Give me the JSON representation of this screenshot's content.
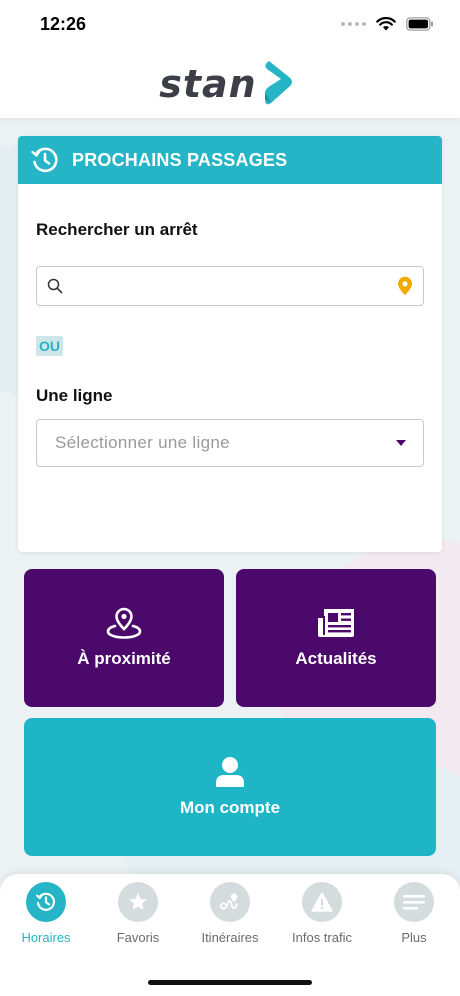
{
  "status_bar": {
    "time": "12:26"
  },
  "header": {
    "logo_text": "stan"
  },
  "departures": {
    "title": "PROCHAINS PASSAGES",
    "stop_label": "Rechercher un arrêt",
    "search": {
      "value": "",
      "placeholder": ""
    },
    "or_label": "OU",
    "line_label": "Une ligne",
    "line_select": {
      "placeholder": "Sélectionner une ligne"
    }
  },
  "tiles": [
    {
      "label": "À proximité",
      "icon": "map-pin-icon"
    },
    {
      "label": "Actualités",
      "icon": "newspaper-icon"
    },
    {
      "label": "Mon compte",
      "icon": "user-icon"
    }
  ],
  "nav": {
    "items": [
      {
        "label": "Horaires",
        "icon": "clock-icon",
        "active": true
      },
      {
        "label": "Favoris",
        "icon": "star-icon",
        "active": false
      },
      {
        "label": "Itinéraires",
        "icon": "route-icon",
        "active": false
      },
      {
        "label": "Infos trafic",
        "icon": "warning-icon",
        "active": false
      },
      {
        "label": "Plus",
        "icon": "menu-icon",
        "active": false
      }
    ]
  },
  "colors": {
    "accent": "#26b5c6",
    "purple": "#4b0a6b",
    "location_pin": "#f2a900"
  }
}
